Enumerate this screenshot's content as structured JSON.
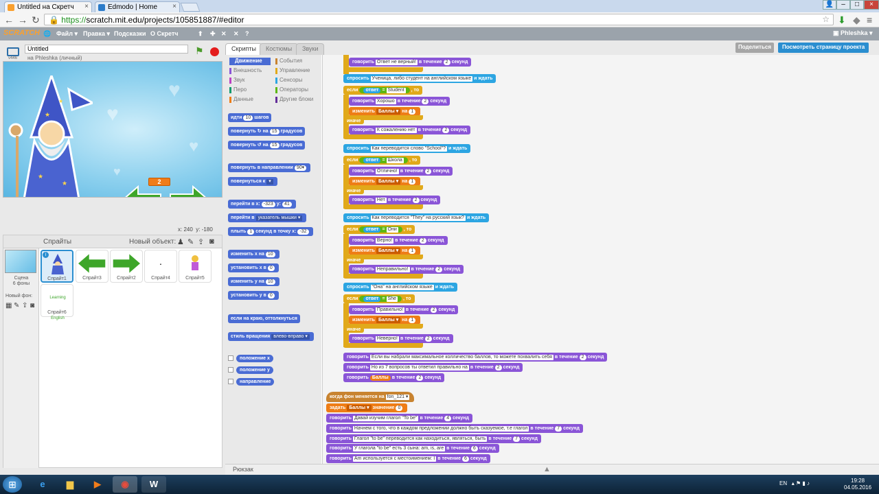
{
  "browser": {
    "tabs": [
      {
        "title": "Untitled на Скретч",
        "active": true
      },
      {
        "title": "Edmodo | Home",
        "active": false
      }
    ],
    "url_scheme": "https://",
    "url_rest": "scratch.mit.edu/projects/105851887/#editor"
  },
  "menubar": {
    "logo": "SCRATCH",
    "file": "Файл ▾",
    "edit": "Правка ▾",
    "tips": "Подсказки",
    "about": "О Скретч",
    "user": "Phleshka ▾"
  },
  "project": {
    "title": "Untitled",
    "byline": "на Phleshka (личный)",
    "version": "v446"
  },
  "stage": {
    "counter": "2",
    "coords_x_label": "x:",
    "coords_x": "240",
    "coords_y_label": "y:",
    "coords_y": "-180"
  },
  "sprites_panel": {
    "title": "Спрайты",
    "new_object": "Новый объект:",
    "scene_label": "Сцена",
    "scene_sub": "6 фоны",
    "new_bg": "Новый фон:",
    "sprites": [
      "Спрайт1",
      "Спрайт3",
      "Спрайт2",
      "Спрайт4",
      "Спрайт5",
      "Спрайт6"
    ],
    "sprite6_text": "Learning English"
  },
  "editor": {
    "tabs": [
      "Скрипты",
      "Костюмы",
      "Звуки"
    ],
    "share": "Поделиться",
    "see_page": "Посмотреть страницу проекта",
    "backpack": "Рюкзак",
    "sprite_x": "x: -323",
    "sprite_y": "y: 41"
  },
  "categories": [
    {
      "label": "Движение",
      "color": "#4a6cd4",
      "active": true
    },
    {
      "label": "События",
      "color": "#c88330"
    },
    {
      "label": "Внешность",
      "color": "#8a55d7"
    },
    {
      "label": "Управление",
      "color": "#e1a91a"
    },
    {
      "label": "Звук",
      "color": "#bb42c3"
    },
    {
      "label": "Сенсоры",
      "color": "#2ca5e2"
    },
    {
      "label": "Перо",
      "color": "#0e9a6c"
    },
    {
      "label": "Операторы",
      "color": "#5cb712"
    },
    {
      "label": "Данные",
      "color": "#ee7d16"
    },
    {
      "label": "Другие блоки",
      "color": "#632d99"
    }
  ],
  "palette": {
    "move": [
      "идти",
      "10",
      "шагов"
    ],
    "turn_right": [
      "повернуть ↻ на",
      "15",
      "градусов"
    ],
    "turn_left": [
      "повернуть ↺ на",
      "15",
      "градусов"
    ],
    "point_dir": [
      "повернуть в направлении",
      "90▾"
    ],
    "point_to": [
      "повернуться к",
      "▾"
    ],
    "goto_xy": [
      "перейти в x:",
      "-323",
      "y:",
      "41"
    ],
    "goto": [
      "перейти в",
      "указатель мышки ▾"
    ],
    "glide": [
      "плыть",
      "1",
      "секунд в точку x:",
      "-32"
    ],
    "change_x": [
      "изменить х на",
      "10"
    ],
    "set_x": [
      "установить х в",
      "0"
    ],
    "change_y": [
      "изменить у на",
      "10"
    ],
    "set_y": [
      "установить у в",
      "0"
    ],
    "bounce": "если на краю, оттолкнуться",
    "rotation": [
      "стиль вращения",
      "влево-вправо ▾"
    ],
    "rep_x": "положение x",
    "rep_y": "положение y",
    "rep_dir": "направление"
  },
  "script": {
    "s0": [
      "говорить",
      "Ответ не верный!",
      "в течение",
      "2",
      "секунд"
    ],
    "q1": [
      "спросить",
      "Ученица, либо студент на английском языке",
      "и ждать"
    ],
    "if1": [
      "если",
      "ответ",
      "=",
      "Student",
      ", то"
    ],
    "say1a": [
      "говорить",
      "Хорошо",
      "в течение",
      "2",
      "секунд"
    ],
    "chg1": [
      "изменить",
      "Баллы ▾",
      "на",
      "1"
    ],
    "else": "иначе",
    "say1b": [
      "говорить",
      "К сожалению нет",
      "в течение",
      "2",
      "секунд"
    ],
    "q2": [
      "спросить",
      "Как переводится слово \"School\"?",
      "и ждать"
    ],
    "if2": [
      "если",
      "ответ",
      "=",
      "Школа",
      ", то"
    ],
    "say2a": [
      "говорить",
      "Отлично!",
      "в течение",
      "2",
      "секунд"
    ],
    "say2b": [
      "говорить",
      "Нет",
      "в течение",
      "2",
      "секунд"
    ],
    "q3": [
      "спросить",
      "Как переводится \"They\" на русский язык?",
      "и ждать"
    ],
    "if3": [
      "если",
      "ответ",
      "=",
      "Они",
      ", то"
    ],
    "say3a": [
      "говорить",
      "Верно!",
      "в течение",
      "2",
      "секунд"
    ],
    "say3b": [
      "говорить",
      "Неправильно!",
      "в течение",
      "2",
      "секунд"
    ],
    "q4": [
      "спросить",
      "\"Она\" на английском языке",
      "и ждать"
    ],
    "if4": [
      "если",
      "ответ",
      "=",
      "She",
      ", то"
    ],
    "say4a": [
      "говорить",
      "Правильно!",
      "в течение",
      "2",
      "секунд"
    ],
    "say4b": [
      "говорить",
      "Неверно!",
      "в течение",
      "2",
      "секунд"
    ],
    "fin1": [
      "говорить",
      "Если вы набрали максимальное колличество баллов, то можете похвалить себя",
      "в течение",
      "2",
      "секунд"
    ],
    "fin2": [
      "говорить",
      "Но из 7 вопросов ты ответил правильно на",
      "в течение",
      "2",
      "секунд"
    ],
    "fin3": [
      "говорить",
      "Баллы",
      "в течение",
      "2",
      "секунд"
    ],
    "hat": [
      "когда фон меняется на",
      "fon_121 ▾"
    ],
    "setvar": [
      "задать",
      "Баллы ▾",
      "значение",
      "0"
    ],
    "t1": [
      "говорить",
      "Давай изучим глагол \"To be\"",
      "в течение",
      "4",
      "секунд"
    ],
    "t2": [
      "говорить",
      "Начнем с того, что в каждом предложении должно быть сказуемое, т.е глагол",
      "в течение",
      "7",
      "секунд"
    ],
    "t3": [
      "говорить",
      "Глагол \"to be\" переводится как находиться, являться, быть",
      "в течение",
      "7",
      "секунд"
    ],
    "t4": [
      "говорить",
      "У глагола \"to be\" есть 3 сына: am, is, are",
      "в течение",
      "6",
      "секунд"
    ],
    "t5": [
      "говорить",
      "Am используется с местоимением: I",
      "в течение",
      "6",
      "секунд"
    ]
  },
  "taskbar": {
    "lang": "EN",
    "time": "19:28",
    "date": "04.05.2016"
  }
}
